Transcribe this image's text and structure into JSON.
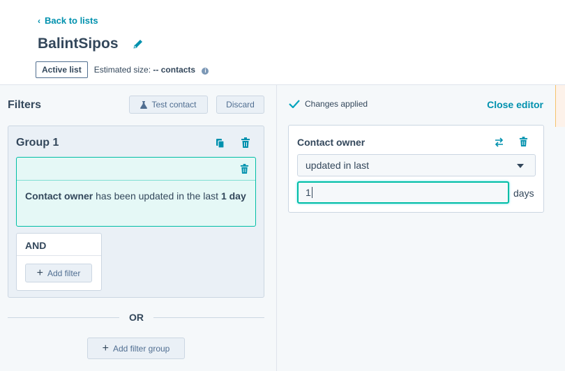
{
  "header": {
    "back_label": "Back to lists",
    "title": "BalintSipos",
    "badge": "Active list",
    "estimated_prefix": "Estimated size:",
    "estimated_value": "-- contacts"
  },
  "filters_panel": {
    "title": "Filters",
    "test_contact_label": "Test contact",
    "discard_label": "Discard",
    "group": {
      "title": "Group 1",
      "filter": {
        "property": "Contact owner",
        "middle": " has been updated in the last ",
        "amount": "1 day"
      },
      "and_label": "AND",
      "add_filter_label": "Add filter"
    },
    "or_label": "OR",
    "add_filter_group_label": "Add filter group"
  },
  "editor_panel": {
    "status": "Changes applied",
    "close_label": "Close editor",
    "card": {
      "title": "Contact owner",
      "operator": "updated in last",
      "value": "1",
      "unit": "days"
    }
  },
  "colors": {
    "accent": "#0091ae",
    "teal": "#00bda5",
    "text": "#33475b",
    "panel_bg": "#f5f8fa"
  }
}
